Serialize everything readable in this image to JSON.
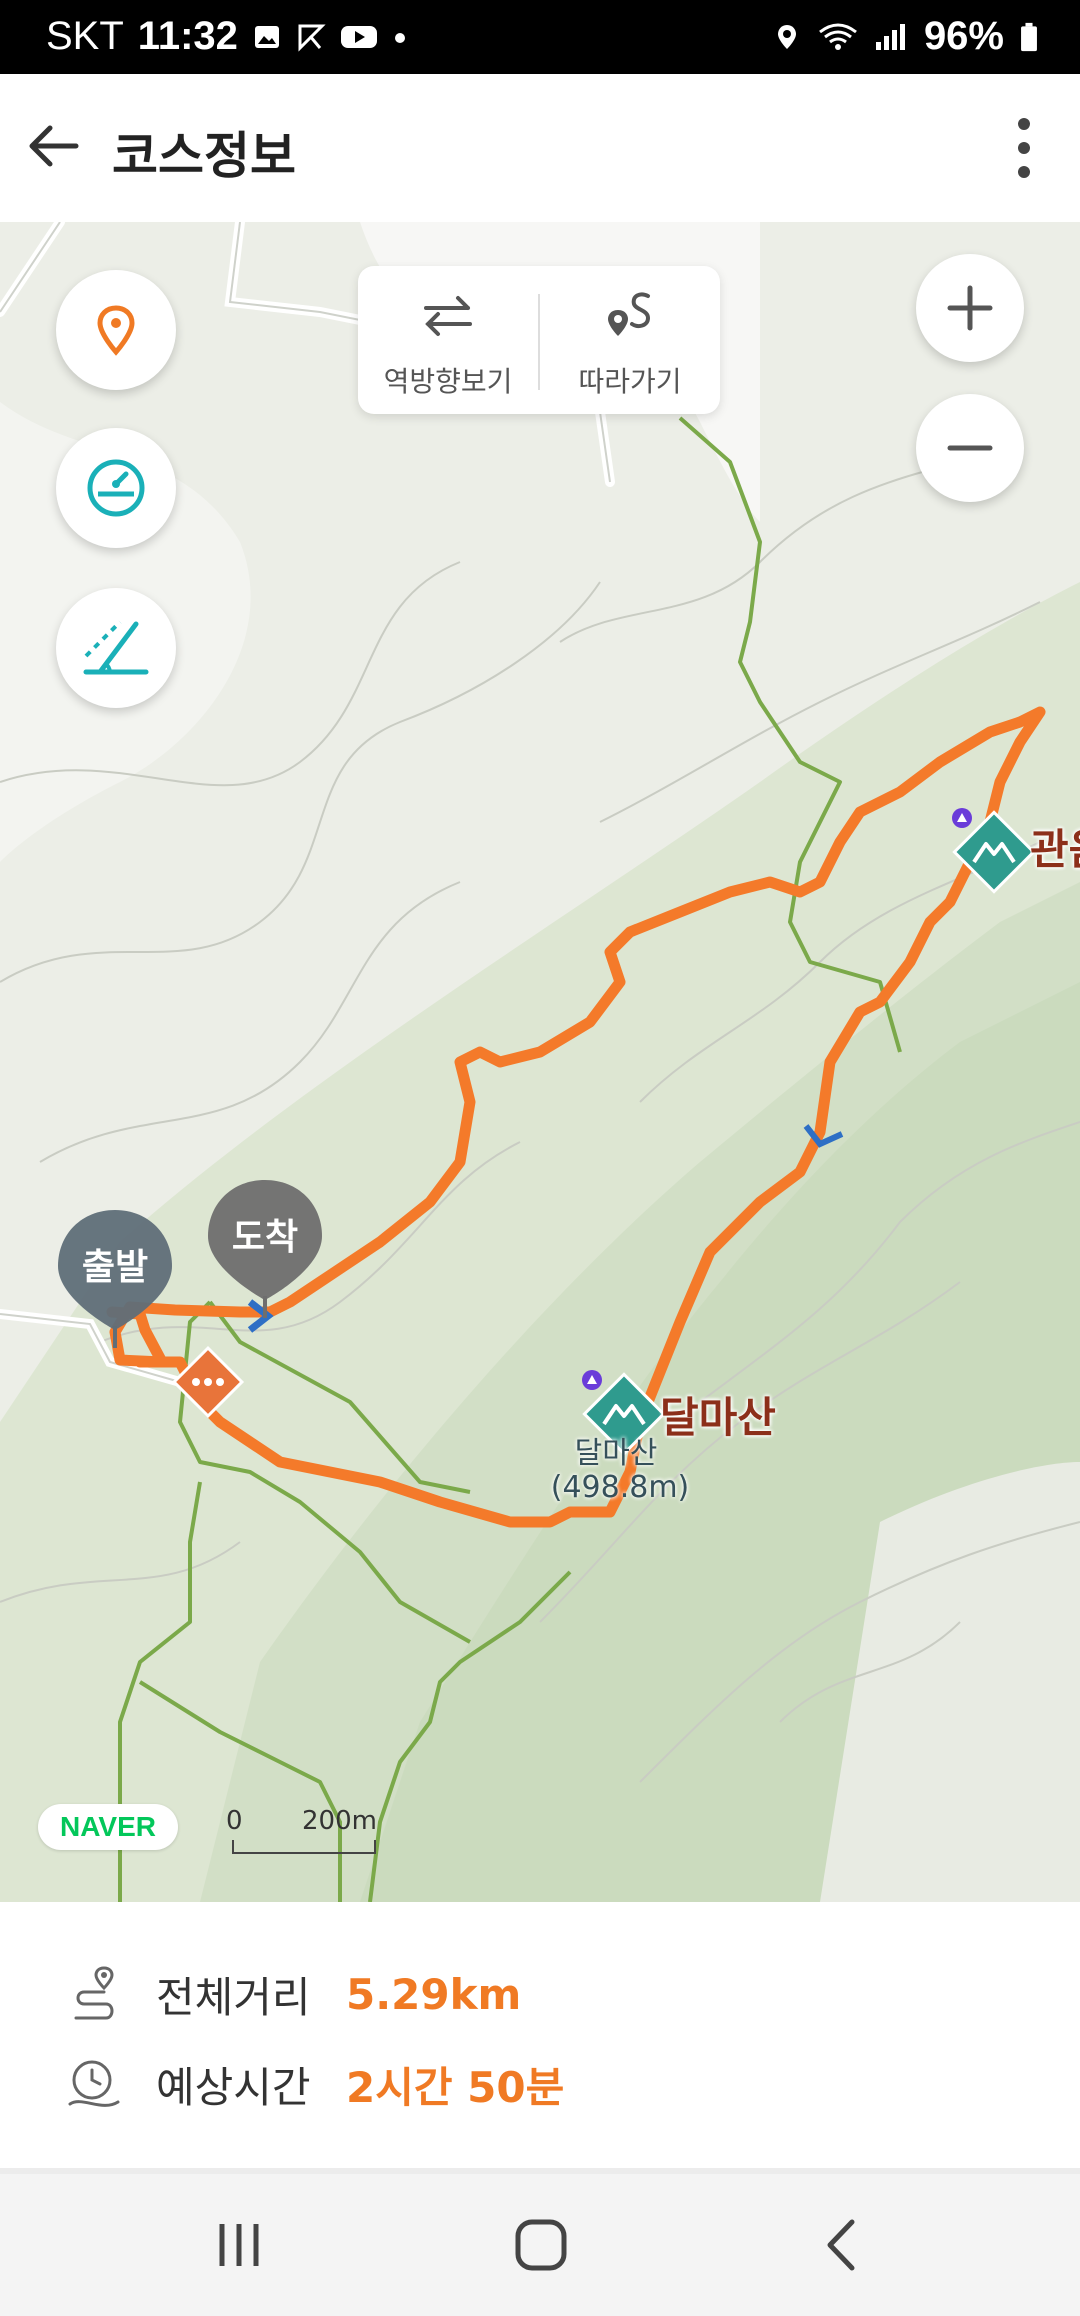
{
  "status_bar": {
    "carrier": "SKT",
    "time": "11:32",
    "battery": "96%",
    "left_icons": [
      "gallery-icon",
      "sync-icon",
      "youtube-icon",
      "dot-icon"
    ],
    "right_icons": [
      "location-icon",
      "wifi-icon",
      "signal-icon",
      "battery-icon"
    ]
  },
  "app_bar": {
    "title": "코스정보"
  },
  "map_tools": {
    "reverse_label": "역방향보기",
    "follow_label": "따라가기"
  },
  "markers": {
    "start_label": "출발",
    "end_label": "도착",
    "peak1_name": "달마산",
    "peak1_sub_name": "달마산",
    "peak1_elevation": "(498.8m)",
    "peak2_name": "관음"
  },
  "map_footer": {
    "brand": "NAVER",
    "scale_start": "0",
    "scale_end": "200m"
  },
  "info": {
    "distance_label": "전체거리",
    "distance_value": "5.29km",
    "time_label": "예상시간",
    "time_value": "2시간 50분"
  },
  "colors": {
    "route": "#f47a2a",
    "trail": "#7ba94a",
    "peak_marker": "#2f9b8e",
    "accent_text": "#f07a24"
  }
}
